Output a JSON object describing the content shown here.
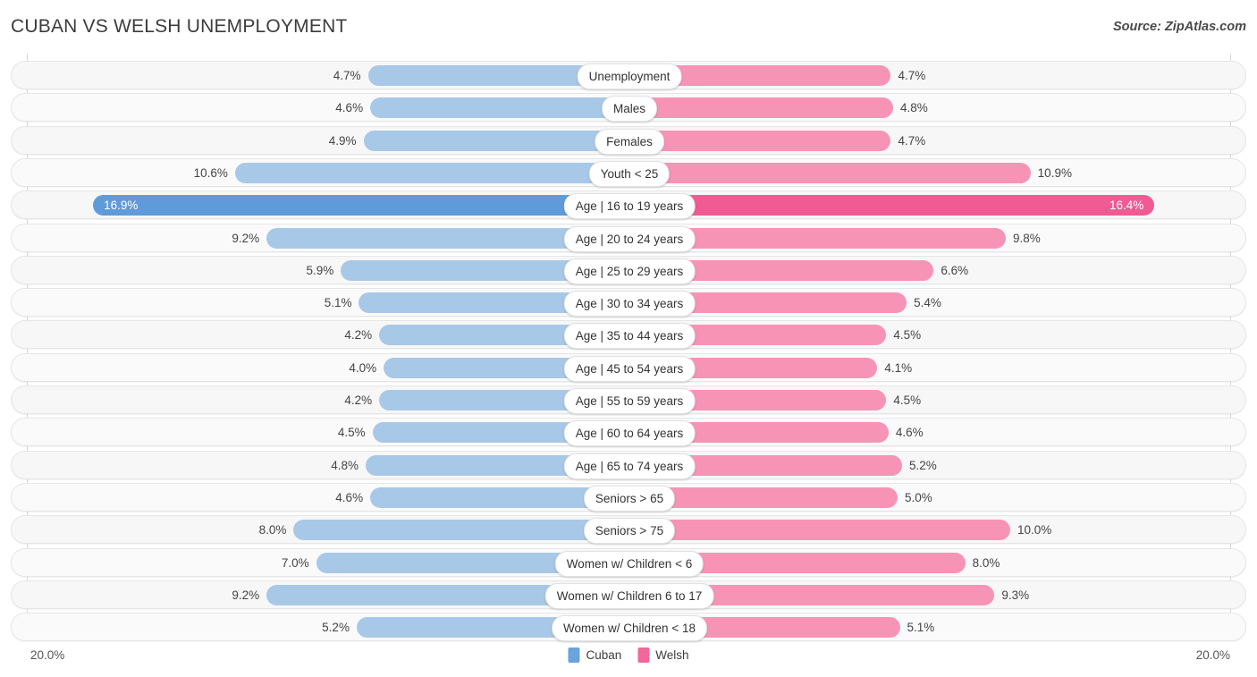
{
  "header": {
    "title": "CUBAN VS WELSH UNEMPLOYMENT",
    "source": "Source: ZipAtlas.com"
  },
  "axis": {
    "left_label": "20.0%",
    "right_label": "20.0%",
    "max": 20.0
  },
  "legend": [
    {
      "label": "Cuban",
      "color": "#6ba3dc"
    },
    {
      "label": "Welsh",
      "color": "#f2679a"
    }
  ],
  "colors": {
    "cuban_normal": "#a8c8e8",
    "cuban_highlight": "#5f9bd9",
    "welsh_normal": "#f794b5",
    "welsh_highlight": "#f05b94",
    "track": "#f7f7f7",
    "track_alt": "#fafafa",
    "gridline": "#d8d8d8"
  },
  "chart_data": {
    "type": "bar",
    "orientation": "horizontal-diverging",
    "title": "CUBAN VS WELSH UNEMPLOYMENT",
    "xlabel": "",
    "ylabel": "",
    "xlim": [
      20.0,
      20.0
    ],
    "grid": true,
    "legend_position": "bottom-center",
    "categories": [
      "Unemployment",
      "Males",
      "Females",
      "Youth < 25",
      "Age | 16 to 19 years",
      "Age | 20 to 24 years",
      "Age | 25 to 29 years",
      "Age | 30 to 34 years",
      "Age | 35 to 44 years",
      "Age | 45 to 54 years",
      "Age | 55 to 59 years",
      "Age | 60 to 64 years",
      "Age | 65 to 74 years",
      "Seniors > 65",
      "Seniors > 75",
      "Women w/ Children < 6",
      "Women w/ Children 6 to 17",
      "Women w/ Children < 18"
    ],
    "series": [
      {
        "name": "Cuban",
        "values": [
          4.7,
          4.6,
          4.9,
          10.6,
          16.9,
          9.2,
          5.9,
          5.1,
          4.2,
          4.0,
          4.2,
          4.5,
          4.8,
          4.6,
          8.0,
          7.0,
          9.2,
          5.2
        ],
        "labels": [
          "4.7%",
          "4.6%",
          "4.9%",
          "10.6%",
          "16.9%",
          "9.2%",
          "5.9%",
          "5.1%",
          "4.2%",
          "4.0%",
          "4.2%",
          "4.5%",
          "4.8%",
          "4.6%",
          "8.0%",
          "7.0%",
          "9.2%",
          "5.2%"
        ]
      },
      {
        "name": "Welsh",
        "values": [
          4.7,
          4.8,
          4.7,
          10.9,
          16.4,
          9.8,
          6.6,
          5.4,
          4.5,
          4.1,
          4.5,
          4.6,
          5.2,
          5.0,
          10.0,
          8.0,
          9.3,
          5.1
        ],
        "labels": [
          "4.7%",
          "4.8%",
          "4.7%",
          "10.9%",
          "16.4%",
          "9.8%",
          "6.6%",
          "5.4%",
          "4.5%",
          "4.1%",
          "4.5%",
          "4.6%",
          "5.2%",
          "5.0%",
          "10.0%",
          "8.0%",
          "9.3%",
          "5.1%"
        ]
      }
    ],
    "highlighted_rows": [
      4
    ]
  }
}
